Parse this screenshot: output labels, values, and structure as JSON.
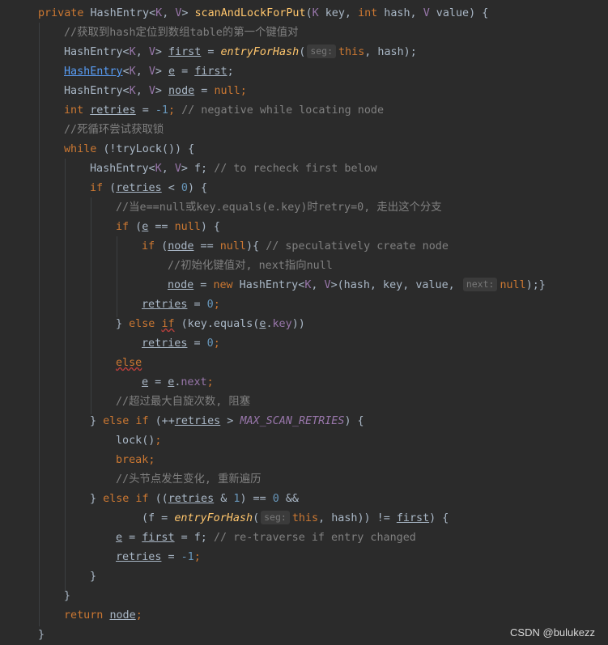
{
  "code": {
    "l1": {
      "mod": "private",
      "type": "HashEntry",
      "lt": "<",
      "k": "K",
      "comma": ", ",
      "v": "V",
      "gt": ">",
      "name": "scanAndLockForPut",
      "open": "(",
      "k2": "K",
      "p1": " key, ",
      "int": "int",
      "p2": " hash, ",
      "v2": "V",
      "p3": " value) {"
    },
    "l2": {
      "comment": "//获取到hash定位到数组table的第一个键值对"
    },
    "l3": {
      "type": "HashEntry<",
      "k": "K",
      "c": ", ",
      "v": "V",
      "gt": "> ",
      "var": "first",
      "eq": " = ",
      "call": "entryForHash",
      "open": "(",
      "hint": "seg:",
      "this": "this",
      "rest": ", hash);"
    },
    "l4": {
      "type": "HashEntry",
      "lt": "<",
      "k": "K",
      "c": ", ",
      "v": "V",
      "gt": "> ",
      "var": "e",
      "eq": " = ",
      "val": "first",
      "semi": ";"
    },
    "l5": {
      "type": "HashEntry<",
      "k": "K",
      "c": ", ",
      "v": "V",
      "gt": "> ",
      "var": "node",
      "eq": " = ",
      "val": "null",
      "semi": ";"
    },
    "l6": {
      "int": "int",
      "sp": " ",
      "var": "retries",
      "eq": " = ",
      "num": "-1",
      "semi": "; ",
      "comment": "// negative while locating node"
    },
    "l7": {
      "comment": "//死循环尝试获取锁"
    },
    "l8": {
      "kw": "while",
      "rest": " (!tryLock()) {"
    },
    "l9": {
      "type": "HashEntry<",
      "k": "K",
      "c": ", ",
      "v": "V",
      "gt": "> ",
      "rest": "f; ",
      "comment": "// to recheck first below"
    },
    "l10": {
      "kw": "if",
      "open": " (",
      "var": "retries",
      "op": " < ",
      "num": "0",
      "close": ") {"
    },
    "l11": {
      "comment": "//当e==null或key.equals(e.key)时retry=0, 走出这个分支"
    },
    "l12": {
      "kw": "if",
      "open": " (",
      "var": "e",
      "op": " == ",
      "nul": "null",
      "close": ") {"
    },
    "l13": {
      "kw": "if",
      "open": " (",
      "var": "node",
      "op": " == ",
      "nul": "null",
      "close": "){ ",
      "comment": "// speculatively create node"
    },
    "l14": {
      "comment": "//初始化键值对, next指向null"
    },
    "l15": {
      "var": "node",
      "eq": " = ",
      "new": "new",
      "type": " HashEntry<",
      "k": "K",
      "c": ", ",
      "v": "V",
      "rest": ">(hash, key, value, ",
      "hint": "next:",
      "nul": "null",
      "close": ");}"
    },
    "l16": {
      "var": "retries",
      "eq": " = ",
      "num": "0",
      "semi": ";"
    },
    "l17": {
      "close": "} ",
      "else": "else",
      "sp": " ",
      "if": "if",
      "rest": " (key.equals(",
      "var": "e",
      "dot": ".",
      "fld": "key",
      "end": "))"
    },
    "l18": {
      "var": "retries",
      "eq": " = ",
      "num": "0",
      "semi": ";"
    },
    "l19": {
      "else": "else"
    },
    "l20": {
      "var": "e",
      "eq": " = ",
      "var2": "e",
      "dot": ".",
      "fld": "next",
      "semi": ";"
    },
    "l21": {
      "comment": "//超过最大自旋次数, 阻塞"
    },
    "l22": {
      "close": "} ",
      "else": "else if",
      "open": " (++",
      "var": "retries",
      "op": " > ",
      "const": "MAX_SCAN_RETRIES",
      "end": ") {"
    },
    "l23": {
      "rest": "lock()",
      "semi": ";"
    },
    "l24": {
      "kw": "break",
      "semi": ";"
    },
    "l25": {
      "comment": "//头节点发生变化, 重新遍历"
    },
    "l26": {
      "close": "} ",
      "else": "else if",
      "open": " ((",
      "var": "retries",
      "op": " & ",
      "num": "1",
      "mid": ") == ",
      "num2": "0",
      "amp": " &&"
    },
    "l27": {
      "open": "(f = ",
      "call": "entryForHash",
      "paren": "(",
      "hint": "seg:",
      "this": "this",
      "mid": ", hash)) != ",
      "var": "first",
      "end": ") {"
    },
    "l28": {
      "var": "e",
      "eq": " = ",
      "var2": "first",
      "mid": " = f; ",
      "comment": "// re-traverse if entry changed"
    },
    "l29": {
      "var": "retries",
      "eq": " = ",
      "num": "-1",
      "semi": ";"
    },
    "l30": {
      "close": "}"
    },
    "l31": {
      "close": "}"
    },
    "l32": {
      "kw": "return",
      "sp": " ",
      "var": "node",
      "semi": ";"
    },
    "l33": {
      "close": "}"
    }
  },
  "watermark": "CSDN @bulukezz",
  "colors": {
    "background": "#2b2b2b",
    "keyword": "#cc7832",
    "method": "#ffc66d",
    "comment": "#808080",
    "number": "#6897bb",
    "type_param": "#9876aa",
    "text": "#a9b7c6"
  }
}
